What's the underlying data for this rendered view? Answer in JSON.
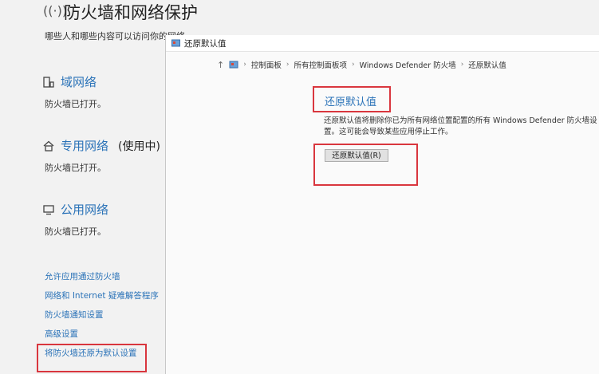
{
  "main": {
    "title": "防火墙和网络保护",
    "description": "哪些人和哪些内容可以访问你的网络"
  },
  "networks": [
    {
      "title": "域网络",
      "extra": "",
      "status": "防火墙已打开。"
    },
    {
      "title": "专用网络",
      "extra": "(使用中)",
      "status": "防火墙已打开。"
    },
    {
      "title": "公用网络",
      "extra": "",
      "status": "防火墙已打开。"
    }
  ],
  "links": [
    "允许应用通过防火墙",
    "网络和 Internet 疑难解答程序",
    "防火墙通知设置",
    "高级设置",
    "将防火墙还原为默认设置"
  ],
  "dialog": {
    "title": "还原默认值",
    "breadcrumb": [
      "控制面板",
      "所有控制面板项",
      "Windows Defender 防火墙",
      "还原默认值"
    ],
    "heading": "还原默认值",
    "description": "还原默认值将删除你已为所有网络位置配置的所有 Windows Defender 防火墙设置。这可能会导致某些应用停止工作。",
    "button_label": "还原默认值(R)"
  },
  "colors": {
    "link": "#2b73b8",
    "highlight": "#d9363e"
  }
}
